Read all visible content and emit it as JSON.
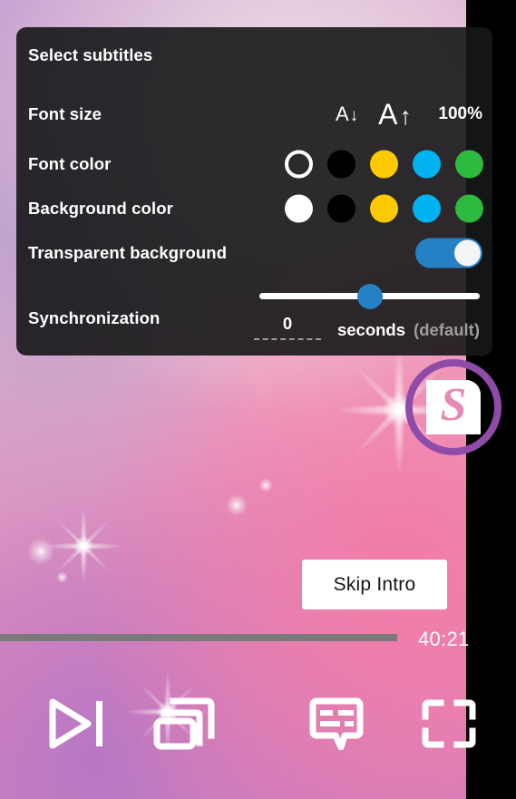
{
  "panel": {
    "title": "Select subtitles",
    "rows": {
      "font_size": {
        "label": "Font size",
        "decrease_glyph": "A",
        "decrease_arrow": "↓",
        "increase_glyph": "A",
        "increase_arrow": "↑",
        "value": "100%"
      },
      "font_color": {
        "label": "Font color",
        "swatches": [
          {
            "name": "white",
            "hex": "#ffffff",
            "selected": true
          },
          {
            "name": "black",
            "hex": "#000000",
            "selected": false
          },
          {
            "name": "yellow",
            "hex": "#fdc900",
            "selected": false
          },
          {
            "name": "cyan",
            "hex": "#00b2f0",
            "selected": false
          },
          {
            "name": "green",
            "hex": "#2eba3e",
            "selected": false
          }
        ]
      },
      "background_color": {
        "label": "Background color",
        "swatches": [
          {
            "name": "white",
            "hex": "#ffffff",
            "selected": false
          },
          {
            "name": "black",
            "hex": "#000000",
            "selected": false
          },
          {
            "name": "yellow",
            "hex": "#fdc900",
            "selected": false
          },
          {
            "name": "cyan",
            "hex": "#00b2f0",
            "selected": false
          },
          {
            "name": "green",
            "hex": "#2eba3e",
            "selected": false
          }
        ]
      },
      "transparent_background": {
        "label": "Transparent background",
        "toggle_state": "on",
        "toggle_color": "#2581c4"
      },
      "synchronization": {
        "label": "Synchronization",
        "slider_position_percent": 50,
        "slider_color": "#2581c4",
        "value": "0",
        "unit": "seconds",
        "note": "(default)"
      }
    }
  },
  "player": {
    "skip_intro_label": "Skip Intro",
    "time_remaining": "40:21",
    "progress_percent": 77,
    "logo_letter": "S",
    "logo_ring_color": "#8f4ba8",
    "controls": [
      {
        "name": "next-episode",
        "label": "Next episode"
      },
      {
        "name": "multi-window",
        "label": "Multi window"
      },
      {
        "name": "subtitles",
        "label": "Subtitles"
      },
      {
        "name": "fullscreen",
        "label": "Fullscreen"
      }
    ]
  }
}
